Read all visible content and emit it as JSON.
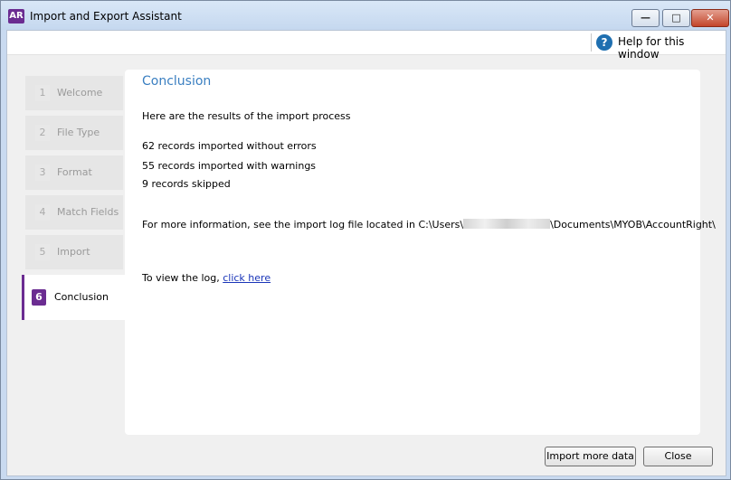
{
  "window": {
    "logo_text": "AR",
    "title": "Import and Export Assistant",
    "brand_color": "#6b2c91"
  },
  "help": {
    "icon_glyph": "?",
    "label": "Help for this window"
  },
  "steps": [
    {
      "num": "1",
      "label": "Welcome",
      "active": false
    },
    {
      "num": "2",
      "label": "File Type",
      "active": false
    },
    {
      "num": "3",
      "label": "Format",
      "active": false
    },
    {
      "num": "4",
      "label": "Match Fields",
      "active": false
    },
    {
      "num": "5",
      "label": "Import",
      "active": false
    },
    {
      "num": "6",
      "label": "Conclusion",
      "active": true
    }
  ],
  "main": {
    "heading": "Conclusion",
    "intro": "Here are the results of the import process",
    "results": [
      "62 records imported without errors",
      "55 records imported with warnings",
      "9 records skipped"
    ],
    "log_info_prefix": "For more information, see the import log file located in C:\\Users\\",
    "log_info_suffix": "\\Documents\\MYOB\\AccountRight\\",
    "view_log_prefix": "To view the log,",
    "view_log_link": "click here"
  },
  "buttons": {
    "import_more": "Import more data",
    "close": "Close"
  }
}
